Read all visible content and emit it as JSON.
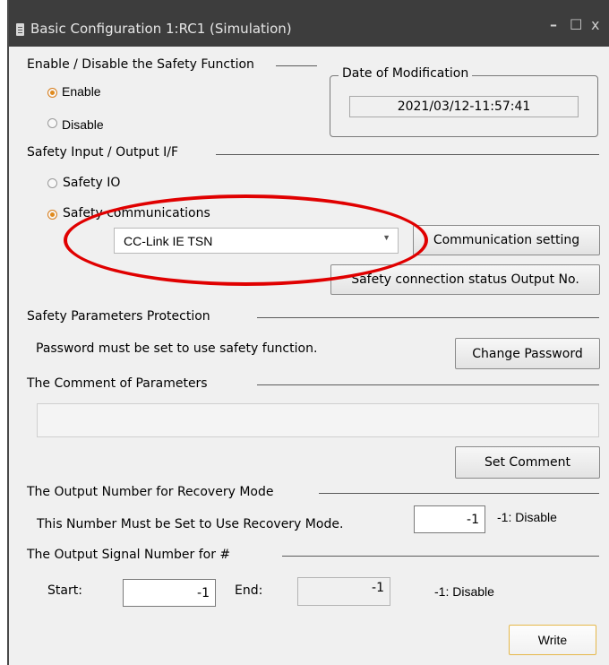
{
  "window": {
    "title": "Basic Configuration 1:RC1  (Simulation)",
    "controls": {
      "minimize": "–",
      "maximize": "□",
      "close": "x"
    }
  },
  "safety_function": {
    "heading": "Enable / Disable the Safety Function",
    "enable_label": "Enable",
    "disable_label": "Disable",
    "selected": "Enable"
  },
  "date_of_modification": {
    "heading": "Date of Modification",
    "value": "2021/03/12-11:57:41"
  },
  "io_interface": {
    "heading": "Safety Input / Output I/F",
    "safety_io_label": "Safety IO",
    "safety_comm_label": "Safety communications",
    "selected": "Safety communications",
    "protocol_selected": "CC-Link IE TSN",
    "comm_setting_button": "Communication setting",
    "status_output_button": "Safety connection status Output No."
  },
  "parameters_protection": {
    "heading": "Safety Parameters Protection",
    "message": "Password must be set to use safety function.",
    "change_password_button": "Change Password"
  },
  "comment": {
    "heading": "The Comment of Parameters",
    "value": "",
    "set_comment_button": "Set Comment"
  },
  "recovery_mode": {
    "heading": "The Output Number for Recovery Mode",
    "message": "This Number Must be Set to Use Recovery Mode.",
    "value": "-1",
    "hint": "-1: Disable"
  },
  "output_signal": {
    "heading": "The Output Signal Number for #",
    "start_label": "Start:",
    "start_value": "-1",
    "end_label": "End:",
    "end_value": "-1",
    "hint": "-1: Disable"
  },
  "write_button": "Write",
  "colors": {
    "titlebar": "#3d3d3d",
    "panel": "#f0f0f0",
    "highlight_oval": "#e00000",
    "radio_checked": "#e08a1e"
  }
}
